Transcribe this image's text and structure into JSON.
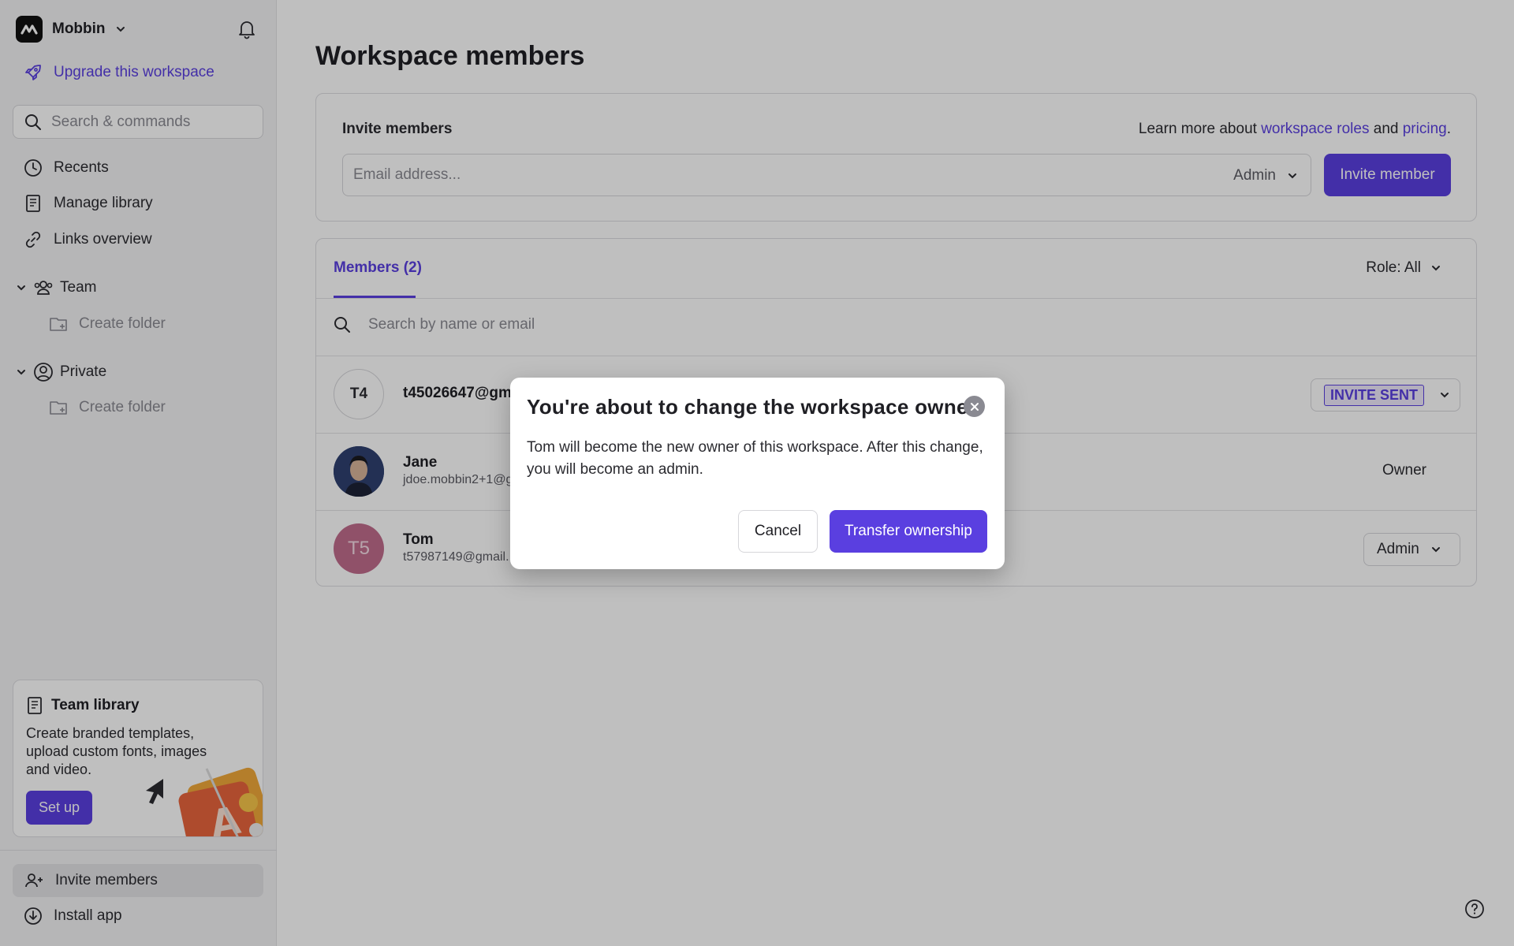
{
  "sidebar": {
    "workspace_name": "Mobbin",
    "upgrade_label": "Upgrade this workspace",
    "search_placeholder": "Search & commands",
    "nav": {
      "recents": "Recents",
      "manage_library": "Manage library",
      "links_overview": "Links overview"
    },
    "sections": {
      "team": "Team",
      "private": "Private",
      "create_folder": "Create folder"
    },
    "promo": {
      "title": "Team library",
      "text": "Create branded templates, upload custom fonts, images and video.",
      "button": "Set up"
    },
    "bottom": {
      "invite_members": "Invite members",
      "install_app": "Install app"
    }
  },
  "main": {
    "title": "Workspace members",
    "invite": {
      "label": "Invite members",
      "learn_prefix": "Learn more about ",
      "learn_link1": "workspace roles",
      "learn_mid": " and ",
      "learn_link2": "pricing",
      "learn_suffix": ".",
      "email_placeholder": "Email address...",
      "role": "Admin",
      "button": "Invite member"
    },
    "members": {
      "tab": "Members (2)",
      "role_filter": "Role: All",
      "search_placeholder": "Search by name or email",
      "rows": [
        {
          "initials": "T4",
          "name": "t45026647@gm",
          "email": "",
          "status": "INVITE SENT"
        },
        {
          "initials": "",
          "name": "Jane",
          "email": "jdoe.mobbin2+1@g",
          "status": "Owner"
        },
        {
          "initials": "T5",
          "name": "Tom",
          "email": "t57987149@gmail.",
          "status": "Admin"
        }
      ]
    }
  },
  "dialog": {
    "title": "You're about to change the workspace owner",
    "body": "Tom will become the new owner of this workspace. After this change, you will become an admin.",
    "cancel": "Cancel",
    "confirm": "Transfer ownership"
  },
  "colors": {
    "accent": "#5a3fe0",
    "overlay": "rgba(0,0,0,0.25)"
  }
}
